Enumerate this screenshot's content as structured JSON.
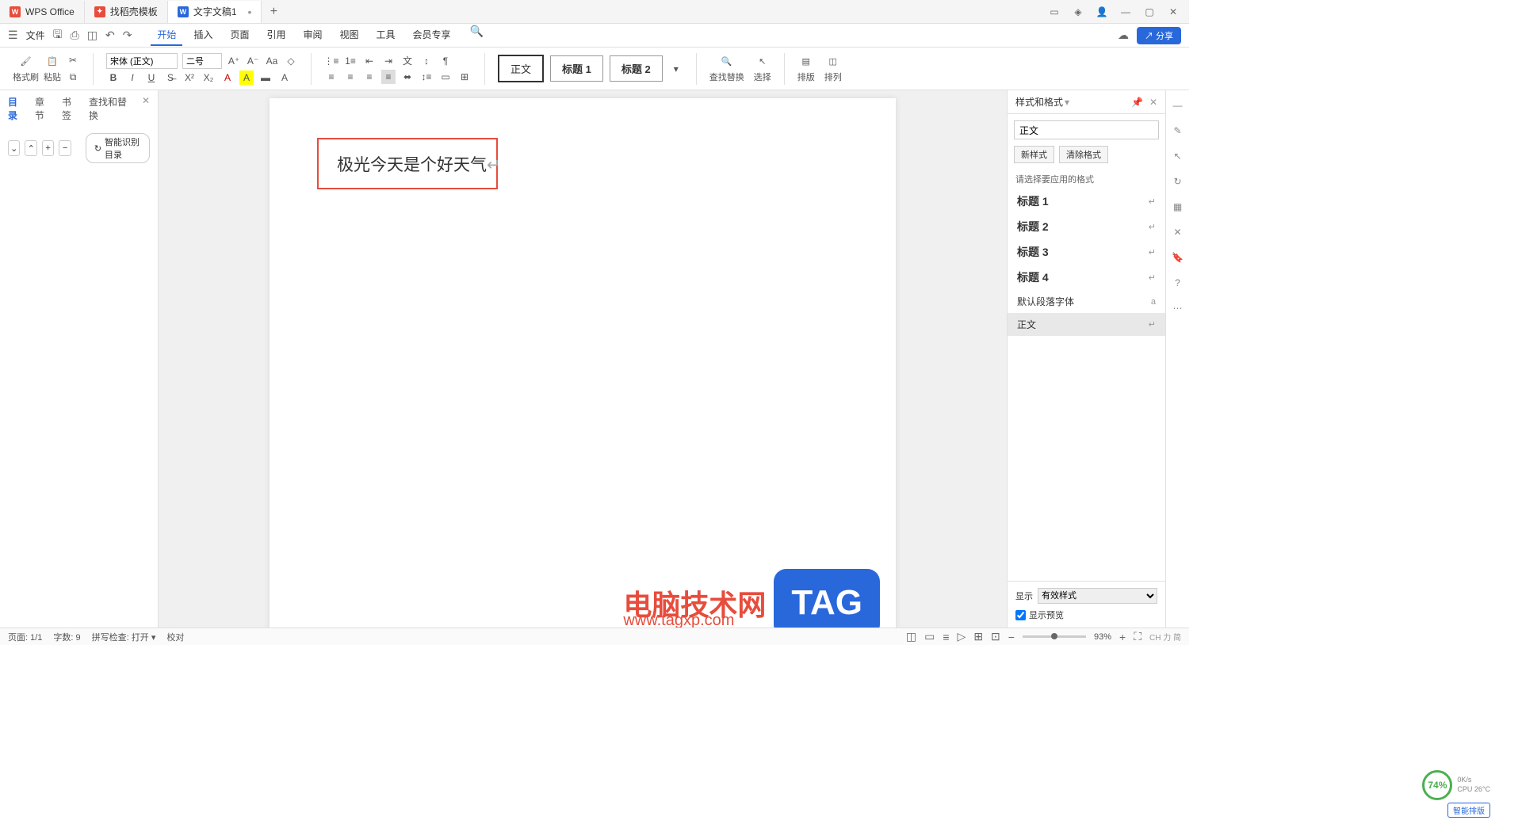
{
  "titlebar": {
    "tabs": [
      {
        "icon": "wps",
        "label": "WPS Office"
      },
      {
        "icon": "tpl",
        "label": "找稻壳模板"
      },
      {
        "icon": "doc",
        "label": "文字文稿1",
        "active": true,
        "dirty": "•"
      }
    ]
  },
  "menubar": {
    "file": "文件",
    "tabs": [
      "开始",
      "插入",
      "页面",
      "引用",
      "审阅",
      "视图",
      "工具",
      "会员专享"
    ],
    "active_tab": "开始",
    "share": "分享"
  },
  "ribbon": {
    "format_brush": "格式刷",
    "paste": "粘贴",
    "font_name": "宋体 (正文)",
    "font_size": "二号",
    "styles": {
      "normal": "正文",
      "h1": "标题 1",
      "h2": "标题 2"
    },
    "find_replace": "查找替换",
    "select": "选择",
    "layout": "排版",
    "arrange": "排列"
  },
  "nav": {
    "tabs": [
      "目录",
      "章节",
      "书签",
      "查找和替换"
    ],
    "active": "目录",
    "smart_toc": "智能识别目录"
  },
  "document": {
    "text": "极光今天是个好天气"
  },
  "watermark": {
    "text": "电脑技术网",
    "url": "www.tagxp.com",
    "tag": "TAG"
  },
  "styles_panel": {
    "title": "样式和格式",
    "current": "正文",
    "new_style": "新样式",
    "clear_format": "清除格式",
    "prompt": "请选择要应用的格式",
    "items": [
      "标题 1",
      "标题 2",
      "标题 3",
      "标题 4",
      "默认段落字体",
      "正文"
    ],
    "selected": "正文",
    "show_label": "显示",
    "show_value": "有效样式",
    "preview": "显示预览"
  },
  "statusbar": {
    "page": "页面: 1/1",
    "words": "字数: 9",
    "spell": "拼写检查: 打开",
    "proof": "校对",
    "zoom": "93%"
  },
  "perf": {
    "pct": "74%",
    "net": "0K/s",
    "cpu": "CPU 26°C"
  },
  "smart_layout": "智能排版",
  "ime": "CH 力 简"
}
